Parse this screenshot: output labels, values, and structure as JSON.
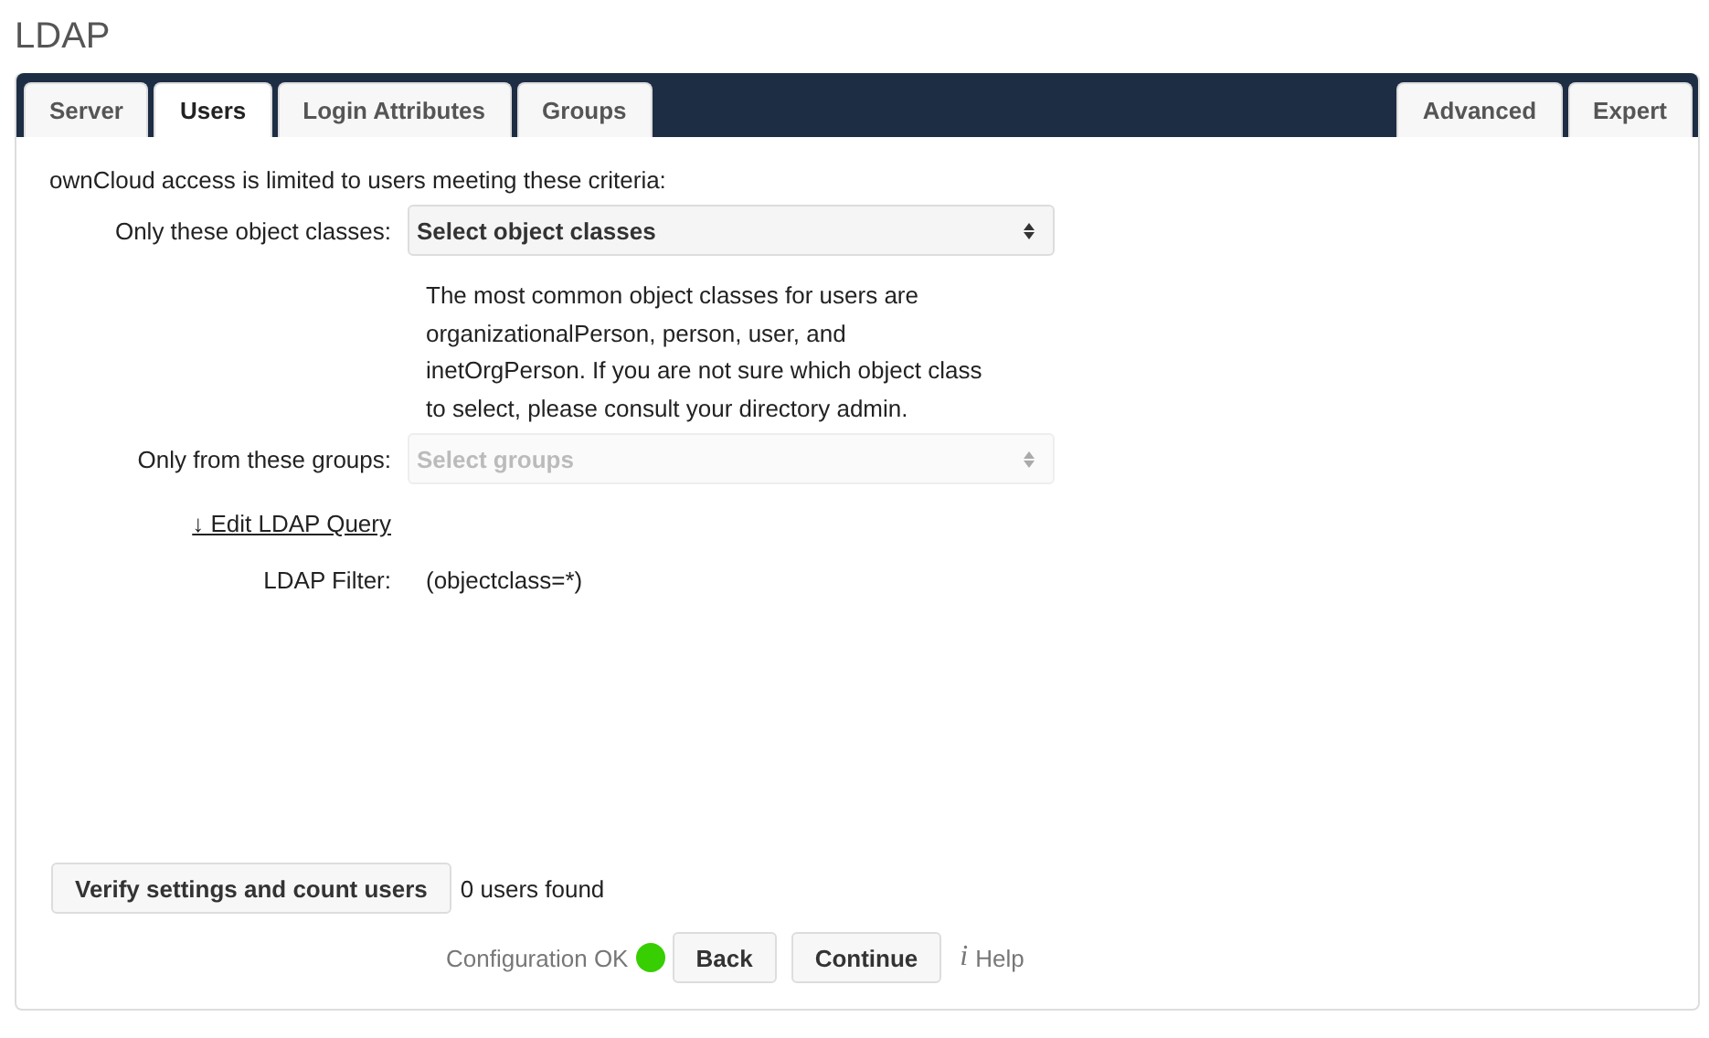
{
  "title": "LDAP",
  "tabs": [
    {
      "label": "Server",
      "selected": false
    },
    {
      "label": "Users",
      "selected": true
    },
    {
      "label": "Login Attributes",
      "selected": false
    },
    {
      "label": "Groups",
      "selected": false
    }
  ],
  "right_tabs": [
    {
      "label": "Advanced",
      "selected": false
    },
    {
      "label": "Expert",
      "selected": false
    }
  ],
  "intro": "ownCloud access is limited to users meeting these criteria:",
  "object_classes": {
    "label": "Only these object classes:",
    "placeholder": "Select object classes",
    "disabled": false
  },
  "object_classes_hint": "The most common object classes for users are organizationalPerson, person, user, and inetOrgPerson. If you are not sure which object class to select, please consult your directory admin.",
  "groups": {
    "label": "Only from these groups:",
    "placeholder": "Select groups",
    "disabled": true
  },
  "edit_query_link": "↓ Edit LDAP Query",
  "filter": {
    "label": "LDAP Filter:",
    "value": "(objectclass=*)"
  },
  "verify_button": "Verify settings and count users",
  "users_found": "0 users found",
  "status": {
    "text": "Configuration OK",
    "color": "#37ce02"
  },
  "buttons": [
    "Back",
    "Continue"
  ],
  "help": {
    "icon": "i",
    "label": "Help"
  }
}
